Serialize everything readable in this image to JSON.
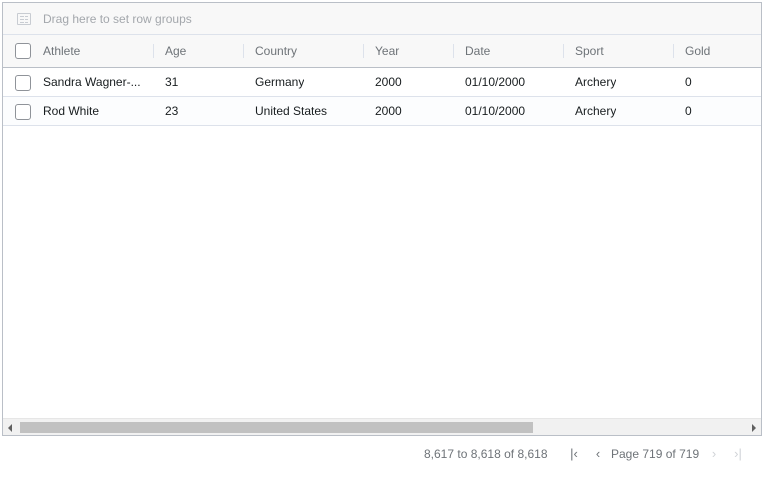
{
  "group_panel": {
    "placeholder": "Drag here to set row groups",
    "icon": "row-group-icon"
  },
  "columns": [
    {
      "label": "Athlete"
    },
    {
      "label": "Age"
    },
    {
      "label": "Country"
    },
    {
      "label": "Year"
    },
    {
      "label": "Date"
    },
    {
      "label": "Sport"
    },
    {
      "label": "Gold"
    }
  ],
  "rows": [
    {
      "athlete": "Sandra Wagner-...",
      "age": "31",
      "country": "Germany",
      "year": "2000",
      "date": "01/10/2000",
      "sport": "Archery",
      "gold": "0"
    },
    {
      "athlete": "Rod White",
      "age": "23",
      "country": "United States",
      "year": "2000",
      "date": "01/10/2000",
      "sport": "Archery",
      "gold": "0"
    }
  ],
  "pagination": {
    "summary_from": "8,617",
    "summary_to_word": "to",
    "summary_to": "8,618",
    "summary_of_word": "of",
    "summary_total": "8,618",
    "page_word": "Page",
    "page_current": "719",
    "page_of_word": "of",
    "page_total": "719",
    "first_icon": "first-page-icon",
    "prev_icon": "previous-page-icon",
    "next_icon": "next-page-icon",
    "last_icon": "last-page-icon"
  },
  "scrollbar": {
    "position": 0.0
  },
  "colors": {
    "border": "#babfc7",
    "header_bg": "#f8f8f8",
    "header_text": "#6e7378",
    "row_border": "#dde2eb"
  }
}
